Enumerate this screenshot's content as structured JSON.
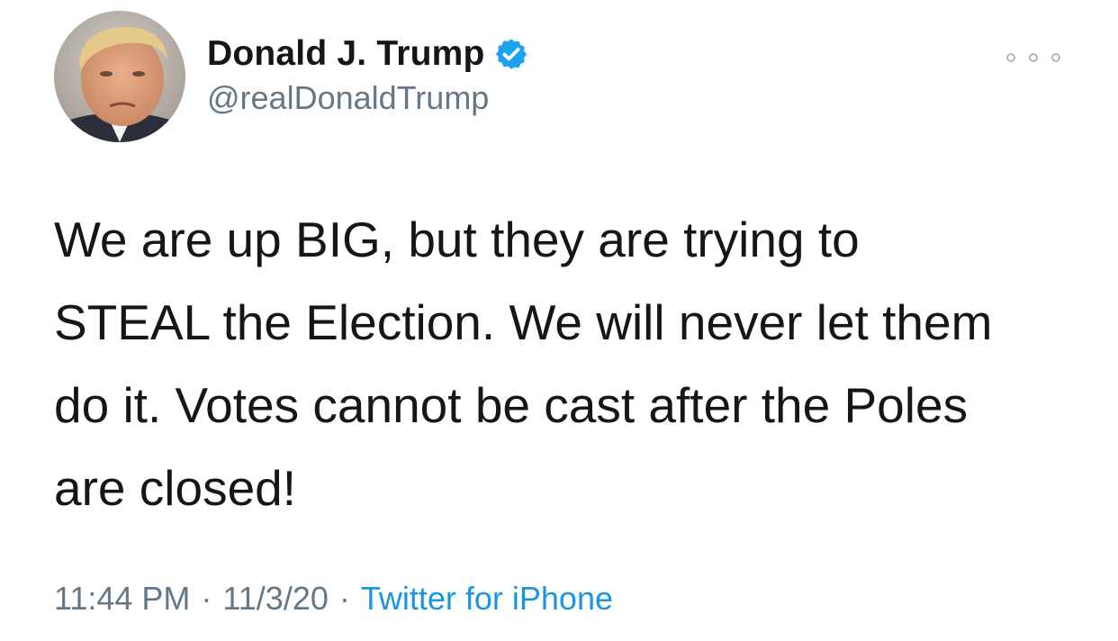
{
  "tweet": {
    "author": {
      "display_name": "Donald J. Trump",
      "handle": "@realDonaldTrump",
      "verified": true,
      "verified_color": "#1da1f2"
    },
    "text_lines": [
      "We are up BIG, but they are trying to",
      "STEAL the Election. We will never let them",
      "do it. Votes cannot be cast after the Poles",
      "are closed!"
    ],
    "meta": {
      "time": "11:44 PM",
      "separator": "·",
      "date": "11/3/20",
      "source": "Twitter for iPhone",
      "source_color": "#1b95e0"
    },
    "icons": {
      "more": "more-options-icon",
      "verified": "verified-badge-icon"
    }
  }
}
